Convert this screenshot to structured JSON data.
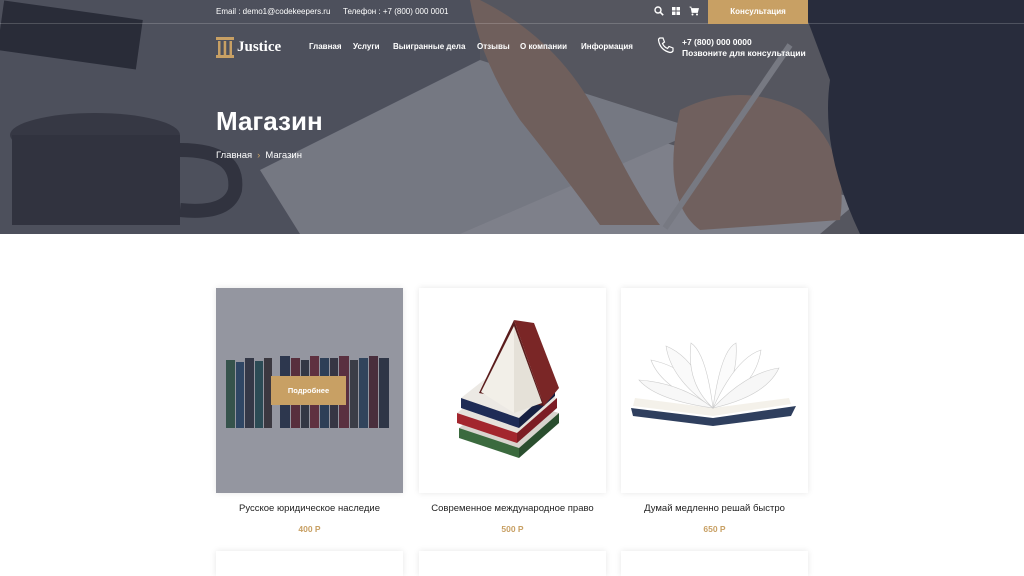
{
  "topbar": {
    "email": "Email : demo1@codekeepers.ru",
    "phone": "Телефон : +7 (800) 000 0001",
    "consult_button": "Консультация",
    "icons": [
      "search-icon",
      "grid-icon",
      "cart-icon"
    ]
  },
  "header": {
    "logo_text": "Justice",
    "nav": [
      "Главная",
      "Услуги",
      "Выигранные дела",
      "Отзывы",
      "О компании",
      "Информация"
    ],
    "phone_number": "+7 (800) 000 0000",
    "phone_caption": "Позвоните для консультации"
  },
  "hero": {
    "title": "Магазин",
    "breadcrumb": [
      "Главная",
      "Магазин"
    ],
    "breadcrumb_separator": "›"
  },
  "products": [
    {
      "name": "Русское юридическое наследие",
      "price": "400 Р",
      "button": "Подробнее"
    },
    {
      "name": "Современное международное право",
      "price": "500 Р"
    },
    {
      "name": "Думай медленно решай быстро",
      "price": "650 Р"
    }
  ],
  "colors": {
    "accent": "#c8a064",
    "overlay": "#262a3a"
  }
}
